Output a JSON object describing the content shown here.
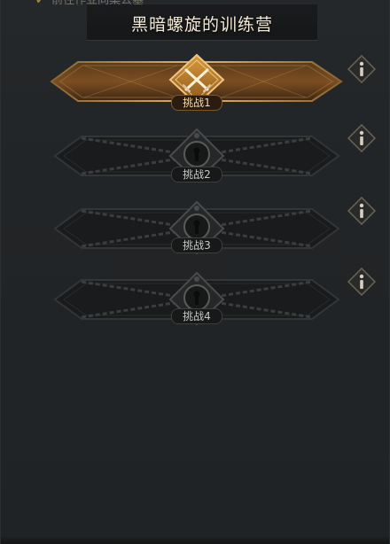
{
  "background_quest": {
    "text": "前往作业同案公墓"
  },
  "header": {
    "title": "黑暗螺旋的训练营"
  },
  "challenges": [
    {
      "label": "挑战1",
      "state": "unlocked",
      "icon": "crossed-swords-icon"
    },
    {
      "label": "挑战2",
      "state": "locked",
      "icon": "keyhole-lock-icon"
    },
    {
      "label": "挑战3",
      "state": "locked",
      "icon": "keyhole-lock-icon"
    },
    {
      "label": "挑战4",
      "state": "locked",
      "icon": "keyhole-lock-icon"
    }
  ],
  "info_button": {
    "glyph": "i",
    "icon": "info-icon"
  },
  "colors": {
    "accent_gold": "#c89a52",
    "locked_gray": "#3a3b3c",
    "title_text": "#f4ead7"
  }
}
